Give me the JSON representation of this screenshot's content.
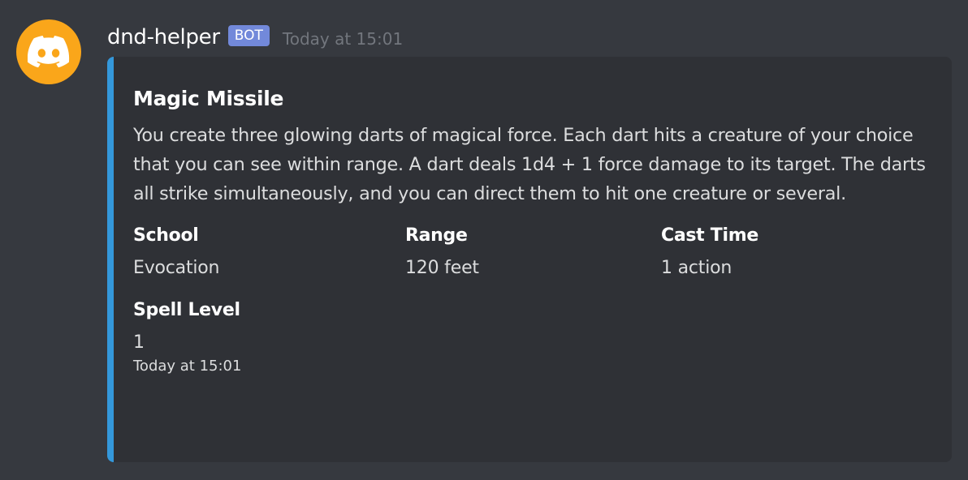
{
  "author": {
    "name": "dnd-helper",
    "tag": "BOT",
    "timestamp": "Today at 15:01",
    "avatar_icon": "discord-logo-icon",
    "avatar_color": "#faa61a"
  },
  "embed": {
    "accent_color": "#3498db",
    "title": "Magic Missile",
    "description": "You create three glowing darts of magical force. Each dart hits a creature of your choice that you can see within range. A dart deals 1d4 + 1 force damage to its target. The darts all strike simultaneously, and you can direct them to hit one creature or several.",
    "fields": [
      {
        "name": "School",
        "value": "Evocation"
      },
      {
        "name": "Range",
        "value": "120 feet"
      },
      {
        "name": "Cast Time",
        "value": "1 action"
      },
      {
        "name": "Spell Level",
        "value": "1"
      }
    ],
    "footer": "Today at 15:01"
  },
  "theme": {
    "background": "#36393f",
    "embed_background": "#2f3136",
    "bot_tag_color": "#7289da"
  }
}
